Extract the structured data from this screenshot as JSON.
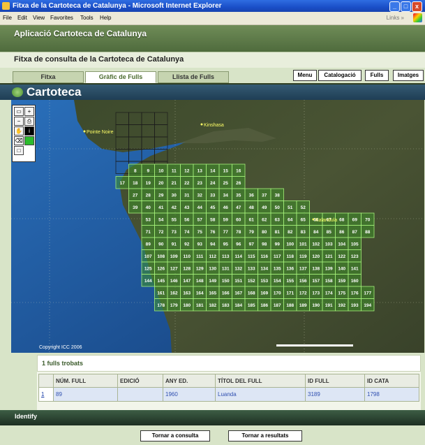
{
  "window": {
    "title": "Fitxa de la Cartoteca de Catalunya - Microsoft Internet Explorer",
    "menu": [
      "File",
      "Edit",
      "View",
      "Favorites",
      "Tools",
      "Help"
    ],
    "links_label": "Links"
  },
  "app": {
    "name": "Aplicació Cartoteca de Catalunya",
    "subtitle": "Fitxa de consulta de la Cartoteca de Catalunya"
  },
  "tabs": [
    {
      "label": "Fitxa",
      "active": false
    },
    {
      "label": "Gràfic de Fulls",
      "active": true
    },
    {
      "label": "Llista de Fulls",
      "active": false
    }
  ],
  "nav_buttons": [
    "Menu",
    "Catalogació",
    "Fulls",
    "Imatges"
  ],
  "section_title": "Cartoteca",
  "map": {
    "labels": [
      {
        "text": "Pointe Noire",
        "kind": "city"
      },
      {
        "text": "Kinshasa",
        "kind": "city"
      },
      {
        "text": "Kalandula",
        "kind": "city"
      }
    ],
    "copyright": "Copyright ICC 2006",
    "sheet_rows": [
      [
        "8",
        "9",
        "10",
        "11",
        "12",
        "13",
        "14",
        "15",
        "16"
      ],
      [
        "17",
        "18",
        "19",
        "20",
        "21",
        "22",
        "23",
        "24",
        "25",
        "26"
      ],
      [
        "27",
        "28",
        "29",
        "30",
        "31",
        "32",
        "33",
        "34",
        "35",
        "36",
        "37",
        "38"
      ],
      [
        "39",
        "40",
        "41",
        "42",
        "43",
        "44",
        "45",
        "46",
        "47",
        "48",
        "49",
        "50",
        "51",
        "52"
      ],
      [
        "53",
        "54",
        "55",
        "56",
        "57",
        "58",
        "59",
        "60",
        "61",
        "62",
        "63",
        "64",
        "65",
        "66",
        "67",
        "68",
        "69",
        "70"
      ],
      [
        "71",
        "72",
        "73",
        "74",
        "75",
        "76",
        "77",
        "78",
        "79",
        "80",
        "81",
        "82",
        "83",
        "84",
        "85",
        "86",
        "87",
        "88"
      ],
      [
        "89",
        "90",
        "91",
        "92",
        "93",
        "94",
        "95",
        "96",
        "97",
        "98",
        "99",
        "100",
        "101",
        "102",
        "103",
        "104",
        "105"
      ],
      [
        "107",
        "108",
        "109",
        "110",
        "111",
        "112",
        "113",
        "114",
        "115",
        "116",
        "117",
        "118",
        "119",
        "120",
        "121",
        "122",
        "123"
      ],
      [
        "125",
        "126",
        "127",
        "128",
        "129",
        "130",
        "131",
        "132",
        "133",
        "134",
        "135",
        "136",
        "137",
        "138",
        "139",
        "140",
        "141"
      ],
      [
        "144",
        "145",
        "146",
        "147",
        "148",
        "149",
        "150",
        "151",
        "152",
        "153",
        "154",
        "155",
        "156",
        "157",
        "158",
        "159",
        "160"
      ],
      [
        "161",
        "162",
        "163",
        "164",
        "165",
        "166",
        "167",
        "168",
        "169",
        "170",
        "171",
        "172",
        "173",
        "174",
        "175",
        "176",
        "177"
      ],
      [
        "178",
        "179",
        "180",
        "181",
        "182",
        "183",
        "184",
        "185",
        "186",
        "187",
        "188",
        "189",
        "190",
        "191",
        "192",
        "193",
        "194"
      ]
    ]
  },
  "results": {
    "found_text": "1 fulls trobats",
    "columns": [
      "",
      "NÚM. FULL",
      "EDICIÓ",
      "ANY ED.",
      "TÍTOL DEL FULL",
      "ID FULL",
      "ID CATA"
    ],
    "rows": [
      [
        "1",
        "89",
        "",
        "1960",
        "Luanda",
        "3189",
        "1798"
      ]
    ]
  },
  "identify_label": "Identify",
  "bottom_buttons": [
    "Tornar a consulta",
    "Tornar a resultats"
  ],
  "colors": {
    "header_green": "#5a7a45",
    "sheet_fill": "#3e8f2a",
    "sheet_border": "#a5f07a",
    "sea": "#1f5fa8"
  }
}
